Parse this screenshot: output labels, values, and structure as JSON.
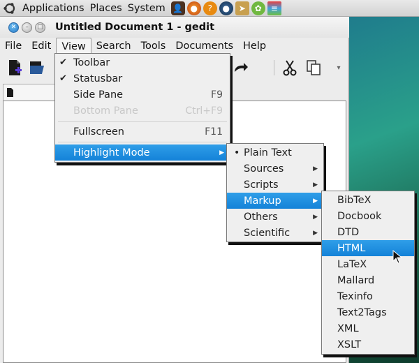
{
  "top_panel": {
    "menus": [
      "Applications",
      "Places",
      "System"
    ]
  },
  "window": {
    "title": "Untitled Document 1 - gedit"
  },
  "menubar": {
    "items": [
      "File",
      "Edit",
      "View",
      "Search",
      "Tools",
      "Documents",
      "Help"
    ],
    "active": "View"
  },
  "view_menu": {
    "items": [
      {
        "label": "Toolbar",
        "checked": true
      },
      {
        "label": "Statusbar",
        "checked": true
      },
      {
        "label": "Side Pane",
        "accel": "F9"
      },
      {
        "label": "Bottom Pane",
        "accel": "Ctrl+F9",
        "disabled": true
      },
      {
        "label": "Fullscreen",
        "accel": "F11"
      },
      {
        "label": "Highlight Mode",
        "submenu": true,
        "highlighted": true
      }
    ]
  },
  "highlight_menu": {
    "items": [
      {
        "label": "Plain Text",
        "selected": true
      },
      {
        "label": "Sources",
        "submenu": true
      },
      {
        "label": "Scripts",
        "submenu": true
      },
      {
        "label": "Markup",
        "submenu": true,
        "highlighted": true
      },
      {
        "label": "Others",
        "submenu": true
      },
      {
        "label": "Scientific",
        "submenu": true
      }
    ]
  },
  "markup_menu": {
    "items": [
      "BibTeX",
      "Docbook",
      "DTD",
      "HTML",
      "LaTeX",
      "Mallard",
      "Texinfo",
      "Text2Tags",
      "XML",
      "XSLT"
    ],
    "highlighted": "HTML"
  },
  "colors": {
    "highlight": "#1e8fe0",
    "menu_bg": "#efefef"
  }
}
